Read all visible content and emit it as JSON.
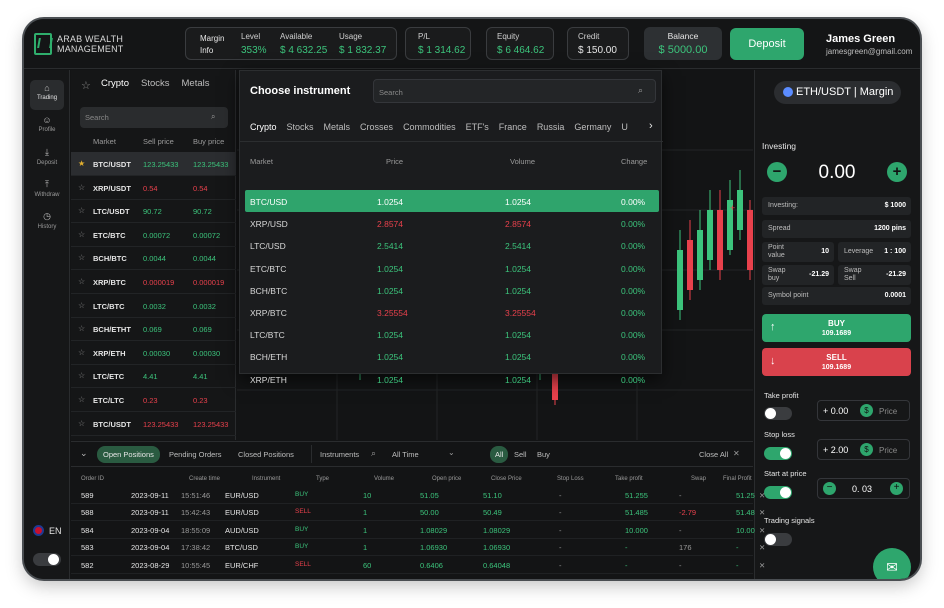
{
  "brand": {
    "line1": "ARAB WEALTH",
    "line2": "MANAGEMENT"
  },
  "header": {
    "margin_info_label": "Margin Info",
    "level": {
      "label": "Level",
      "value": "353%"
    },
    "available": {
      "label": "Available",
      "value": "$ 4 632.25"
    },
    "usage": {
      "label": "Usage",
      "value": "$ 1 832.37"
    },
    "pl": {
      "label": "P/L",
      "value": "$ 1 314.62"
    },
    "equity": {
      "label": "Equity",
      "value": "$ 6 464.62"
    },
    "credit": {
      "label": "Credit",
      "value": "$ 150.00"
    },
    "balance": {
      "label": "Balance",
      "value": "$ 5000.00"
    },
    "deposit_label": "Deposit",
    "user": {
      "name": "James Green",
      "email": "jamesgreen@gmail.com"
    }
  },
  "rail": {
    "items": [
      {
        "label": "Trading",
        "icon": "home-icon"
      },
      {
        "label": "Profile",
        "icon": "user-icon"
      },
      {
        "label": "Deposit",
        "icon": "deposit-icon"
      },
      {
        "label": "Withdraw",
        "icon": "withdraw-icon"
      },
      {
        "label": "History",
        "icon": "history-icon"
      }
    ],
    "language": "EN"
  },
  "markets": {
    "tabs": [
      "Crypto",
      "Stocks",
      "Metals"
    ],
    "search_placeholder": "Search",
    "columns": [
      "Market",
      "Sell price",
      "Buy price"
    ],
    "rows": [
      {
        "symbol": "BTC/USDT",
        "sell": "123.25433",
        "buy": "123.25433",
        "fav": true,
        "trend": "green",
        "selected": true
      },
      {
        "symbol": "XRP/USDT",
        "sell": "0.54",
        "buy": "0.54",
        "fav": false,
        "trend": "red"
      },
      {
        "symbol": "LTC/USDT",
        "sell": "90.72",
        "buy": "90.72",
        "fav": false,
        "trend": "green"
      },
      {
        "symbol": "ETC/BTC",
        "sell": "0.00072",
        "buy": "0.00072",
        "fav": false,
        "trend": "green"
      },
      {
        "symbol": "BCH/BTC",
        "sell": "0.0044",
        "buy": "0.0044",
        "fav": false,
        "trend": "green"
      },
      {
        "symbol": "XRP/BTC",
        "sell": "0.000019",
        "buy": "0.000019",
        "fav": false,
        "trend": "red"
      },
      {
        "symbol": "LTC/BTC",
        "sell": "0.0032",
        "buy": "0.0032",
        "fav": false,
        "trend": "green"
      },
      {
        "symbol": "BCH/ETHT",
        "sell": "0.069",
        "buy": "0.069",
        "fav": false,
        "trend": "green"
      },
      {
        "symbol": "XRP/ETH",
        "sell": "0.00030",
        "buy": "0.00030",
        "fav": false,
        "trend": "green"
      },
      {
        "symbol": "LTC/ETC",
        "sell": "4.41",
        "buy": "4.41",
        "fav": false,
        "trend": "green"
      },
      {
        "symbol": "ETC/LTC",
        "sell": "0.23",
        "buy": "0.23",
        "fav": false,
        "trend": "red"
      },
      {
        "symbol": "BTC/USDT",
        "sell": "123.25433",
        "buy": "123.25433",
        "fav": false,
        "trend": "red"
      }
    ]
  },
  "instrument": {
    "title": "Choose instrument",
    "search_placeholder": "Search",
    "tabs": [
      "Crypto",
      "Stocks",
      "Metals",
      "Crosses",
      "Commodities",
      "ETF's",
      "France",
      "Russia",
      "Germany",
      "U"
    ],
    "columns": [
      "Market",
      "Price",
      "Volume",
      "Change"
    ],
    "rows": [
      {
        "market": "BTC/USD",
        "price": "1.0254",
        "volume": "1.0254",
        "change": "0.00%",
        "trend": "green",
        "selected": true
      },
      {
        "market": "XRP/USD",
        "price": "2.8574",
        "volume": "2.8574",
        "change": "0.00%",
        "trend": "red"
      },
      {
        "market": "LTC/USD",
        "price": "2.5414",
        "volume": "2.5414",
        "change": "0.00%",
        "trend": "green"
      },
      {
        "market": "ETC/BTC",
        "price": "1.0254",
        "volume": "1.0254",
        "change": "0.00%",
        "trend": "green"
      },
      {
        "market": "BCH/BTC",
        "price": "1.0254",
        "volume": "1.0254",
        "change": "0.00%",
        "trend": "green"
      },
      {
        "market": "XRP/BTC",
        "price": "3.25554",
        "volume": "3.25554",
        "change": "0.00%",
        "trend": "red"
      },
      {
        "market": "LTC/BTC",
        "price": "1.0254",
        "volume": "1.0254",
        "change": "0.00%",
        "trend": "green"
      },
      {
        "market": "BCH/ETH",
        "price": "1.0254",
        "volume": "1.0254",
        "change": "0.00%",
        "trend": "green"
      },
      {
        "market": "XRP/ETH",
        "price": "1.0254",
        "volume": "1.0254",
        "change": "0.00%",
        "trend": "green"
      }
    ]
  },
  "trade": {
    "pair": "ETH/USDT | Margin",
    "investing_label": "Investing",
    "investing_value": "0.00",
    "investing": {
      "label": "Investing:",
      "value": "$ 1000"
    },
    "spread": {
      "label": "Spread",
      "value": "1200 pins"
    },
    "point_value": {
      "label": "Point value",
      "value": "10"
    },
    "leverage": {
      "label": "Leverage",
      "value": "1 : 100"
    },
    "swap_buy": {
      "label": "Swap buy",
      "value": "-21.29"
    },
    "swap_sell": {
      "label": "Swap Sell",
      "value": "-21.29"
    },
    "symbol_point": {
      "label": "Symbol point",
      "value": "0.0001"
    },
    "buy": {
      "label": "BUY",
      "value": "109.1689"
    },
    "sell": {
      "label": "SELL",
      "value": "109.1689"
    },
    "take_profit": {
      "label": "Take profit",
      "value": "+ 0.00",
      "unit": "Price",
      "enabled": false
    },
    "stop_loss": {
      "label": "Stop loss",
      "value": "+ 2.00",
      "unit": "Price",
      "enabled": true
    },
    "start_at_price": {
      "label": "Start at price",
      "value": "0. 03",
      "enabled": true
    },
    "trading_signals": {
      "label": "Trading signals",
      "enabled": false
    }
  },
  "positions": {
    "tabs": [
      "Open Positions",
      "Pending Orders",
      "Closed Positions"
    ],
    "instruments_label": "Instruments",
    "time_filter": "All Time",
    "side_filters": [
      "All",
      "Sell",
      "Buy"
    ],
    "close_all": "Close All",
    "columns": [
      "Order ID",
      "Create time",
      "Instrument",
      "Type",
      "Volume",
      "Open price",
      "Close Price",
      "Stop Loss",
      "Take profit",
      "Swap",
      "Final Profit"
    ],
    "rows": [
      {
        "id": "589",
        "date": "2023-09-11",
        "time": "15:51:46",
        "instrument": "EUR/USD",
        "type": "BUY",
        "volume": "10",
        "open": "51.05",
        "close": "51.10",
        "sl": "-",
        "tp": "51.255",
        "swap": "-",
        "profit": "51.25"
      },
      {
        "id": "588",
        "date": "2023-09-11",
        "time": "15:42:43",
        "instrument": "EUR/USD",
        "type": "SELL",
        "volume": "1",
        "open": "50.00",
        "close": "50.49",
        "sl": "-",
        "tp": "51.485",
        "swap": "-2.79",
        "profit": "51.48"
      },
      {
        "id": "584",
        "date": "2023-09-04",
        "time": "18:55:09",
        "instrument": "AUD/USD",
        "type": "BUY",
        "volume": "1",
        "open": "1.08029",
        "close": "1.08029",
        "sl": "-",
        "tp": "10.000",
        "swap": "-",
        "profit": "10.00"
      },
      {
        "id": "583",
        "date": "2023-09-04",
        "time": "17:38:42",
        "instrument": "BTC/USD",
        "type": "BUY",
        "volume": "1",
        "open": "1.06930",
        "close": "1.06930",
        "sl": "-",
        "tp": "-",
        "swap": "176",
        "profit": "-"
      },
      {
        "id": "582",
        "date": "2023-08-29",
        "time": "10:55:45",
        "instrument": "EUR/CHF",
        "type": "SELL",
        "volume": "60",
        "open": "0.6406",
        "close": "0.64048",
        "sl": "-",
        "tp": "-",
        "swap": "-",
        "profit": "-"
      }
    ]
  },
  "colors": {
    "accent": "#2ea66d",
    "up": "#3cc47c",
    "down": "#e8414c",
    "background": "#131415"
  }
}
